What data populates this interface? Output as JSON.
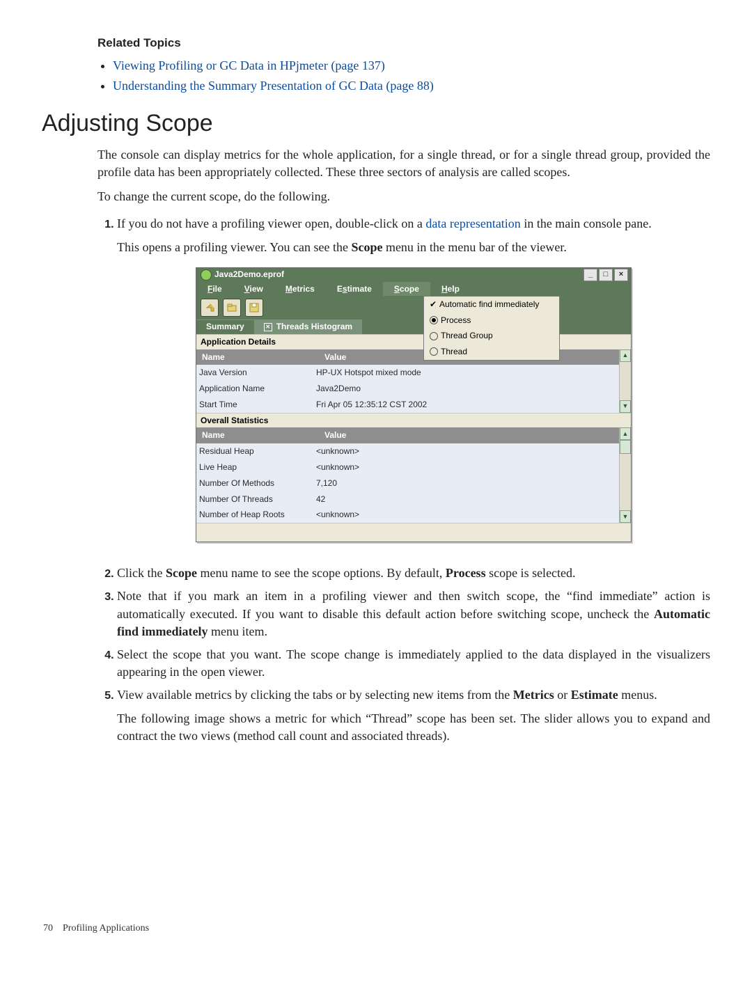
{
  "related": {
    "title": "Related Topics",
    "items": [
      "Viewing Profiling or GC Data in HPjmeter (page 137)",
      "Understanding the Summary Presentation of GC Data (page 88)"
    ]
  },
  "heading": "Adjusting Scope",
  "para1": "The console can display metrics for the whole application, for a single thread, or for a single thread group, provided the profile data has been appropriately collected. These three sectors of analysis are called scopes.",
  "para2": "To change the current scope, do the following.",
  "steps": {
    "s1a": "If you do not have a profiling viewer open, double-click on a ",
    "s1link": "data representation",
    "s1b": " in the main console pane.",
    "s1c_a": "This opens a profiling viewer. You can see the ",
    "s1c_scope": "Scope",
    "s1c_b": " menu in the menu bar of the viewer.",
    "s2a": "Click the ",
    "s2scope": "Scope",
    "s2b": " menu name to see the scope options. By default, ",
    "s2proc": "Process",
    "s2c": " scope is selected.",
    "s3a": "Note that if you mark an item in a profiling viewer and then switch scope, the “find immediate” action is automatically executed. If you want to disable this default action before switching scope, uncheck the ",
    "s3afi": "Automatic find immediately",
    "s3b": " menu item.",
    "s4": "Select the scope that you want. The scope change is immediately applied to the data displayed in the visualizers appearing in the open viewer.",
    "s5a": "View available metrics by clicking the tabs or by selecting new items from the ",
    "s5metrics": "Metrics",
    "s5b": " or ",
    "s5estimate": "Estimate",
    "s5c": " menus.",
    "s5d": "The following image shows a metric for which “Thread” scope has been set. The slider allows you to expand and contract the two views (method call count and associated threads)."
  },
  "window": {
    "title": "Java2Demo.eprof",
    "sys": {
      "min": "_",
      "max": "□",
      "close": "×"
    },
    "menubar": {
      "file_u": "F",
      "file_r": "ile",
      "view_u": "V",
      "view_r": "iew",
      "metrics_u": "M",
      "metrics_r": "etrics",
      "estimate_pre": "E",
      "estimate_u": "s",
      "estimate_post": "timate",
      "scope_u": "S",
      "scope_r": "cope",
      "help_u": "H",
      "help_r": "elp"
    },
    "scope_menu": {
      "auto": "Automatic find immediately",
      "process": "Process",
      "thread_group": "Thread Group",
      "thread": "Thread"
    },
    "tabs": {
      "summary": "Summary",
      "threads": "Threads Histogram"
    },
    "section1": "Application Details",
    "grid_hdr_name": "Name",
    "grid_hdr_value": "Value",
    "app_details": [
      {
        "name": "Java Version",
        "value": "HP-UX Hotspot mixed mode"
      },
      {
        "name": "Application Name",
        "value": "Java2Demo"
      },
      {
        "name": "Start Time",
        "value": "Fri Apr 05 12:35:12 CST 2002"
      }
    ],
    "section2": "Overall Statistics",
    "overall": [
      {
        "name": "Residual Heap",
        "value": "<unknown>"
      },
      {
        "name": "Live Heap",
        "value": "<unknown>"
      },
      {
        "name": "Number Of Methods",
        "value": "7,120"
      },
      {
        "name": "Number Of Threads",
        "value": "42"
      },
      {
        "name": "Number of Heap Roots",
        "value": "<unknown>"
      }
    ]
  },
  "footer": {
    "page": "70",
    "chapter": "Profiling Applications"
  }
}
